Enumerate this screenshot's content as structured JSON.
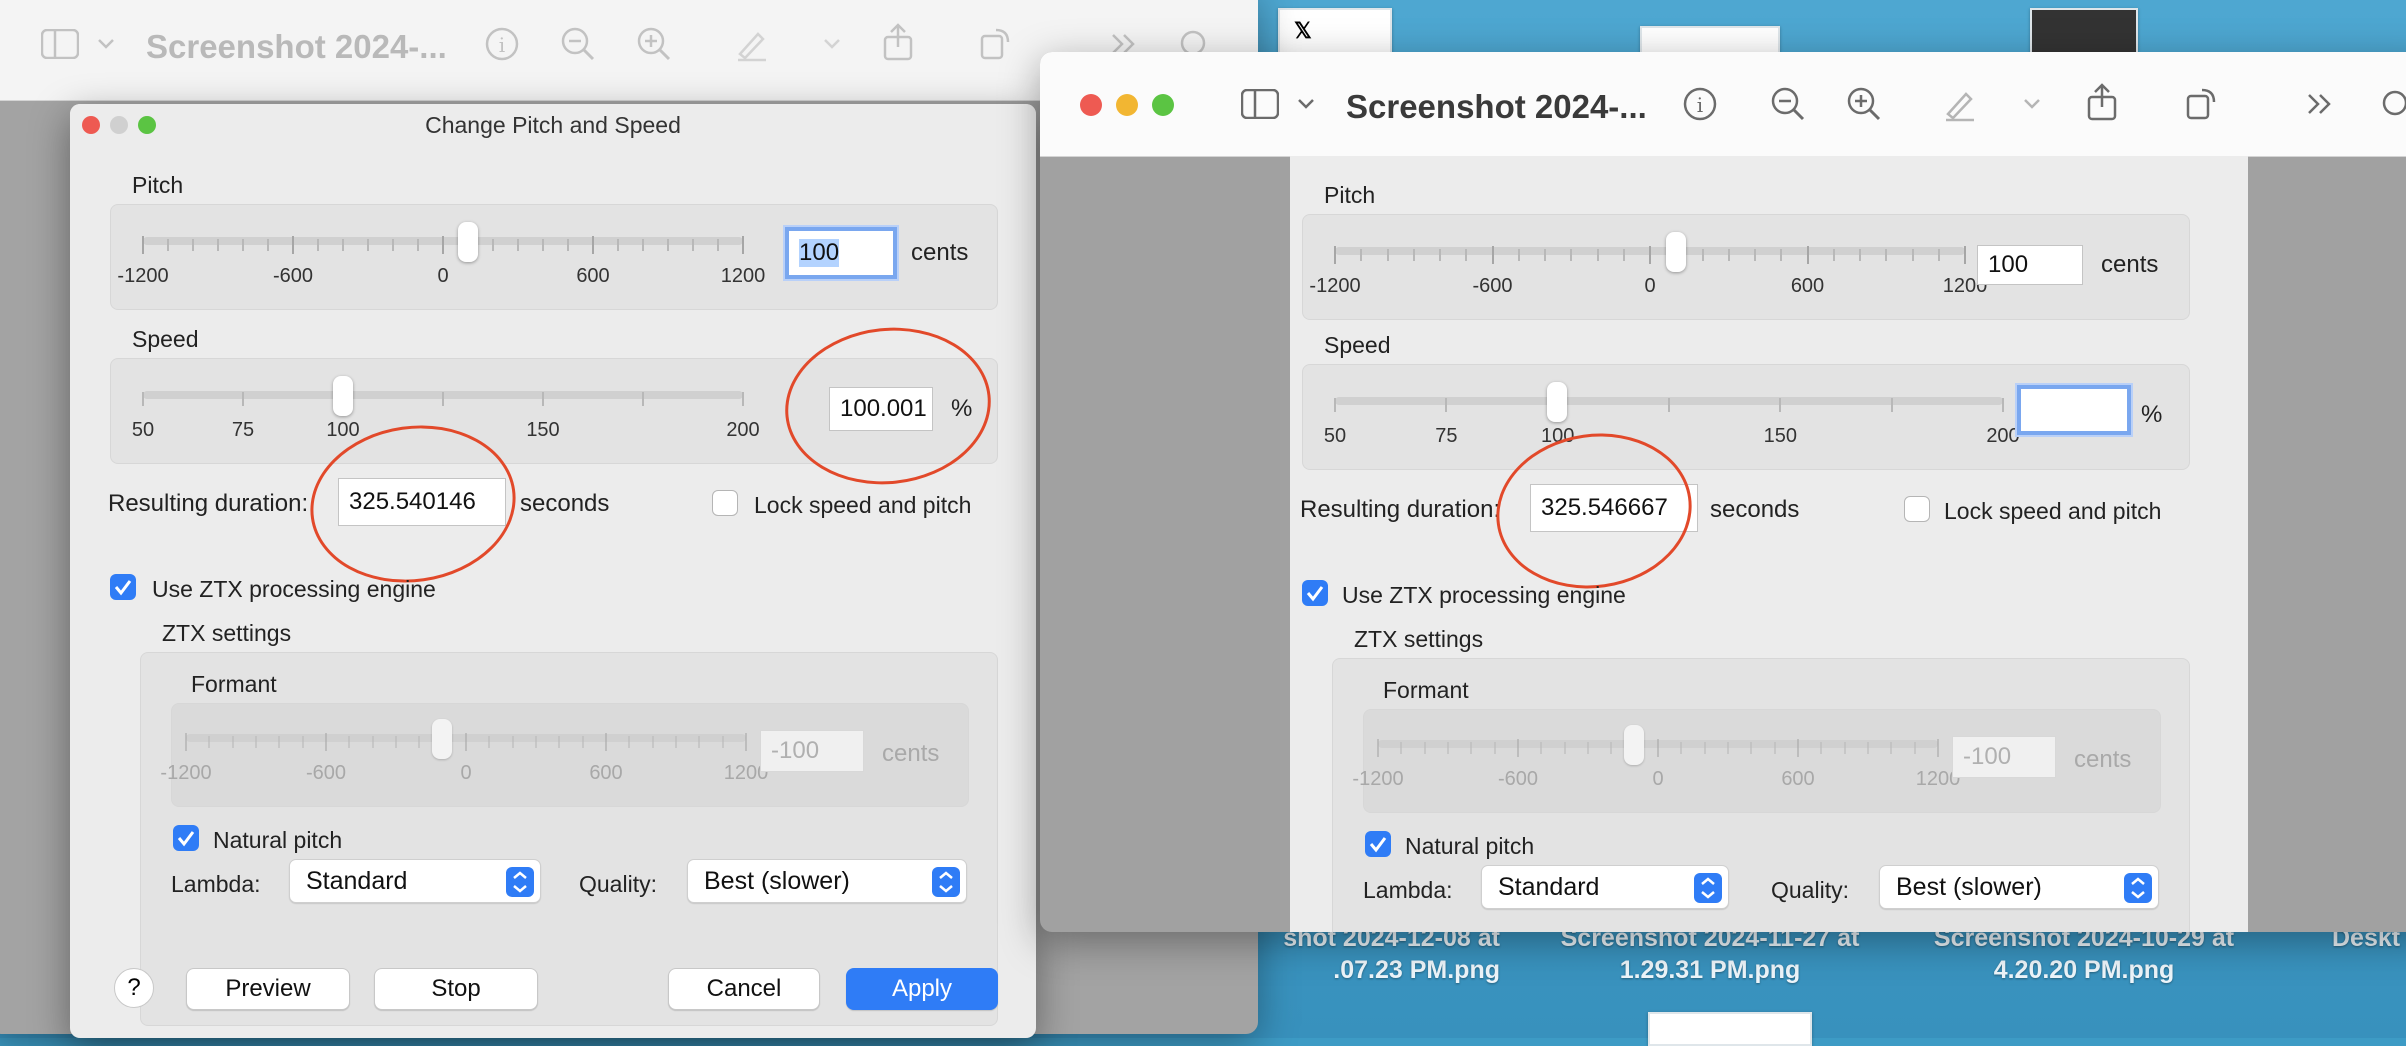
{
  "desktop": {
    "files": [
      {
        "line1": "shot 2024-12-08 at",
        "line2": ".07.23 PM.png"
      },
      {
        "line1": "Screenshot 2024-11-27 at",
        "line2": "1.29.31 PM.png"
      },
      {
        "line1": "Screenshot 2024-10-29 at",
        "line2": "4.20.20 PM.png"
      },
      {
        "line1": "Deskt",
        "line2": ""
      }
    ]
  },
  "back_window": {
    "title": "Screenshot 2024-..."
  },
  "front_window": {
    "title": "Screenshot 2024-..."
  },
  "icons": {
    "sidebar": "sidebar-toggle-icon",
    "info": "info-icon",
    "zoom_out": "zoom-out-icon",
    "zoom_in": "zoom-in-icon",
    "markup": "markup-pen-icon",
    "share": "share-icon",
    "rotate": "rotate-icon",
    "more": "chevron-double-right-icon",
    "search": "search-icon"
  },
  "colors": {
    "accent": "#2f7cf6",
    "annotation": "#e2492a"
  },
  "dialog_left": {
    "title": "Change Pitch and Speed",
    "pitch": {
      "label": "Pitch",
      "value": "100",
      "unit": "cents",
      "ticks": [
        "-1200",
        "-600",
        "0",
        "600",
        "1200"
      ],
      "slider": 0.0417
    },
    "speed": {
      "label": "Speed",
      "value": "100.001",
      "unit": "%",
      "ticks": [
        "50",
        "75",
        "100",
        "150",
        "200"
      ]
    },
    "duration": {
      "label": "Resulting duration:",
      "value": "325.540146",
      "unit": "seconds"
    },
    "lock": {
      "label": "Lock speed and pitch",
      "checked": false
    },
    "ztx": {
      "label": "Use ZTX processing engine",
      "checked": true
    },
    "ztx_settings": "ZTX settings",
    "formant": {
      "label": "Formant",
      "value": "-100",
      "unit": "cents",
      "ticks": [
        "-1200",
        "-600",
        "0",
        "600",
        "1200"
      ]
    },
    "natural_pitch": {
      "label": "Natural pitch",
      "checked": true
    },
    "lambda": {
      "label": "Lambda:",
      "value": "Standard"
    },
    "quality": {
      "label": "Quality:",
      "value": "Best (slower)"
    },
    "buttons": {
      "help": "?",
      "preview": "Preview",
      "stop": "Stop",
      "cancel": "Cancel",
      "apply": "Apply"
    }
  },
  "dialog_right": {
    "pitch": {
      "label": "Pitch",
      "value": "100",
      "unit": "cents",
      "ticks": [
        "-1200",
        "-600",
        "0",
        "600",
        "1200"
      ]
    },
    "speed": {
      "label": "Speed",
      "value": "",
      "unit": "%",
      "ticks": [
        "50",
        "75",
        "100",
        "150",
        "200"
      ]
    },
    "duration": {
      "label": "Resulting duration:",
      "value": "325.546667",
      "unit": "seconds"
    },
    "lock": {
      "label": "Lock speed and pitch",
      "checked": false
    },
    "ztx": {
      "label": "Use ZTX processing engine",
      "checked": true
    },
    "ztx_settings": "ZTX settings",
    "formant": {
      "label": "Formant",
      "value": "-100",
      "unit": "cents",
      "ticks": [
        "-1200",
        "-600",
        "0",
        "600",
        "1200"
      ]
    },
    "natural_pitch": {
      "label": "Natural pitch",
      "checked": true
    },
    "lambda": {
      "label": "Lambda:",
      "value": "Standard"
    },
    "quality": {
      "label": "Quality:",
      "value": "Best (slower)"
    }
  }
}
